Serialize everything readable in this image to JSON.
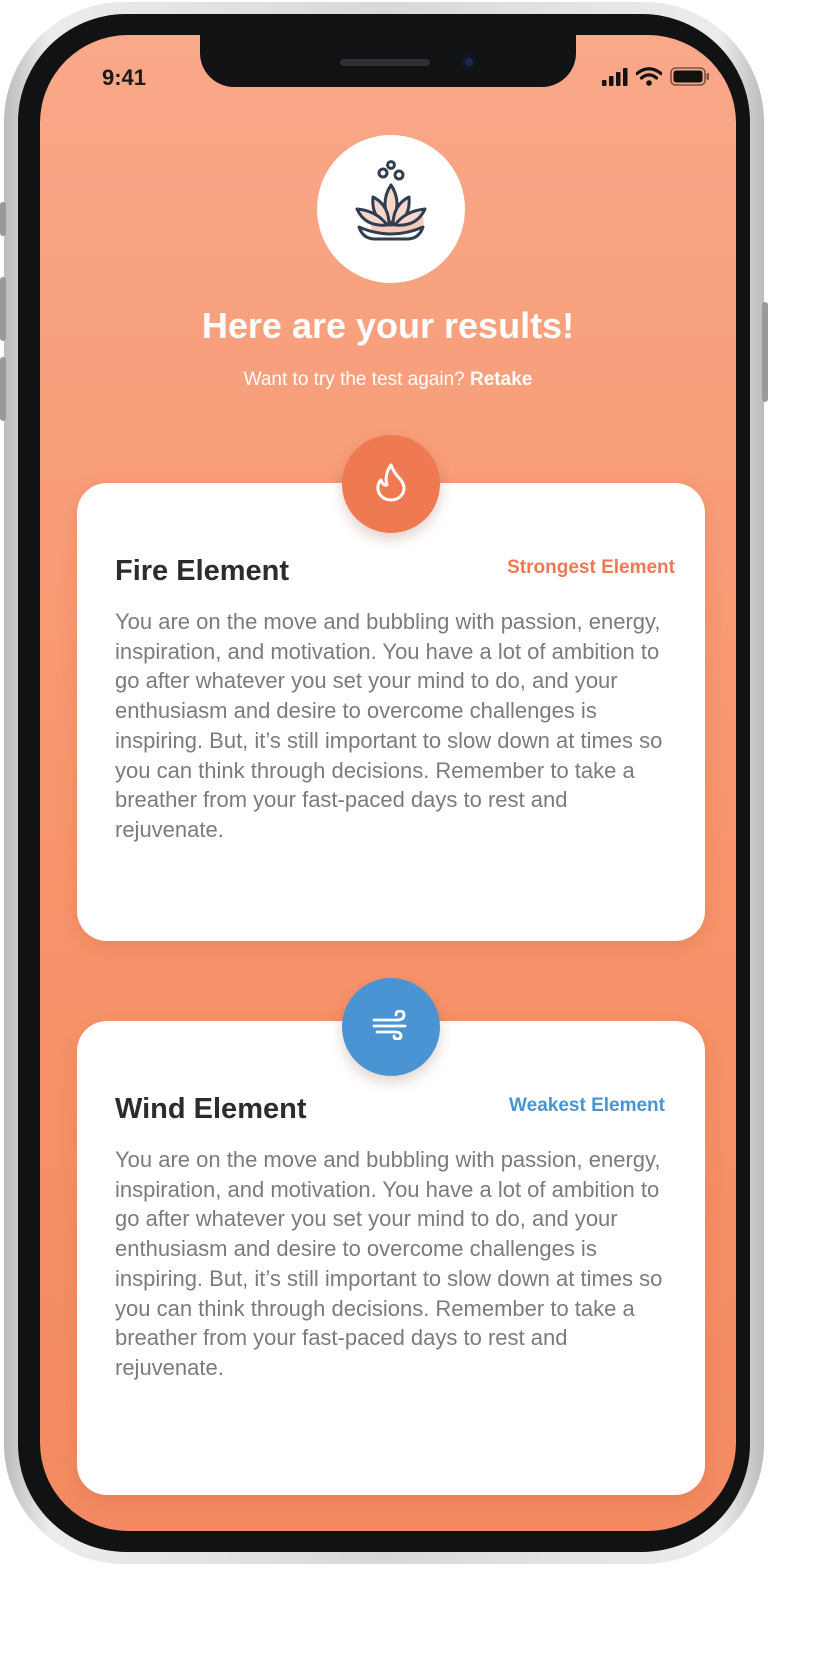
{
  "status_bar": {
    "time": "9:41"
  },
  "header": {
    "title": "Here are your results!",
    "subtitle_prefix": "Want to try the test again?",
    "retake_label": "Retake"
  },
  "results": [
    {
      "title": "Fire Element",
      "tag": "Strongest Element",
      "icon": "flame-icon",
      "accent_color": "#ef7a52",
      "description": "You are on the move and bubbling with passion, energy, inspiration, and motivation. You have a lot of ambition to go after whatever you set your mind to do, and your enthusiasm and desire to overcome challenges is inspiring. But, it’s still important to slow down at times so you can think through decisions. Remember to take a breather from your fast-paced days to rest and rejuvenate."
    },
    {
      "title": "Wind Element",
      "tag": "Weakest Element",
      "icon": "wind-icon",
      "accent_color": "#4a94d4",
      "description": "You are on the move and bubbling with passion, energy, inspiration, and motivation. You have a lot of ambition to go after whatever you set your mind to do, and your enthusiasm and desire to overcome challenges is inspiring. But, it’s still important to slow down at times so you can think through decisions. Remember to take a breather from your fast-paced days to rest and rejuvenate."
    }
  ],
  "colors": {
    "background_top": "#f9a889",
    "background_bottom": "#f48a61",
    "fire_accent": "#ef7a52",
    "wind_accent": "#4a94d4",
    "card_bg": "#ffffff",
    "heading_text": "#2c2c2c",
    "body_text": "#7b7b7b"
  },
  "icons": {
    "hero": "lotus-icon",
    "status": [
      "cellular-signal-icon",
      "wifi-icon",
      "battery-icon"
    ]
  }
}
